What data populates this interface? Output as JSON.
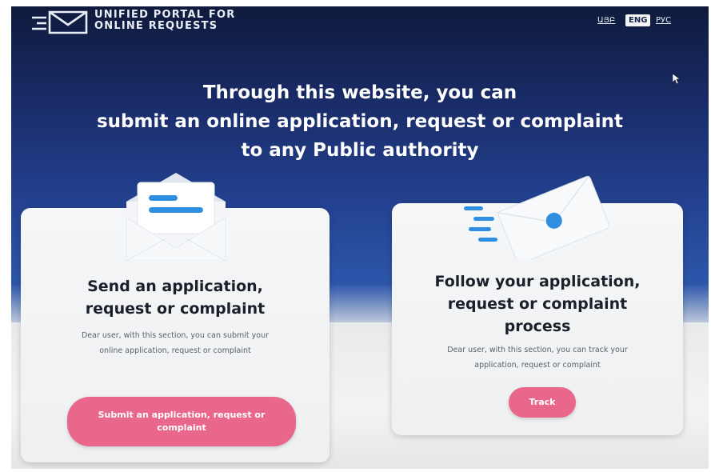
{
  "header": {
    "brand_line1": "UNIFIED PORTAL FOR",
    "brand_line2": "ONLINE REQUESTS",
    "languages": [
      {
        "label": "ԱՅԲ",
        "active": false
      },
      {
        "label": "ENG",
        "active": true
      },
      {
        "label": "РУС",
        "active": false
      }
    ]
  },
  "hero": {
    "line1": "Through this website, you can",
    "line2": "submit an online application, request or complaint",
    "line3": "to any Public authority"
  },
  "cards": {
    "send": {
      "icon": "open-envelope-icon",
      "title_line1": "Send an application,",
      "title_line2": "request or complaint",
      "desc_line1": "Dear user, with this section, you can submit your",
      "desc_line2": "online application, request or complaint",
      "button_line1": "Submit an application, request or",
      "button_line2": "complaint"
    },
    "track": {
      "icon": "sealed-envelope-icon",
      "title_line1": "Follow your application,",
      "title_line2": "request or complaint",
      "title_line3": "process",
      "desc_line1": "Dear user, with this section, you can track your",
      "desc_line2": "application, request or complaint",
      "button_label": "Track"
    }
  },
  "colors": {
    "background_top": "#0f1a3c",
    "background_mid": "#23418f",
    "accent_pink": "#e9678b",
    "illustration_blue": "#2e8fe0"
  }
}
